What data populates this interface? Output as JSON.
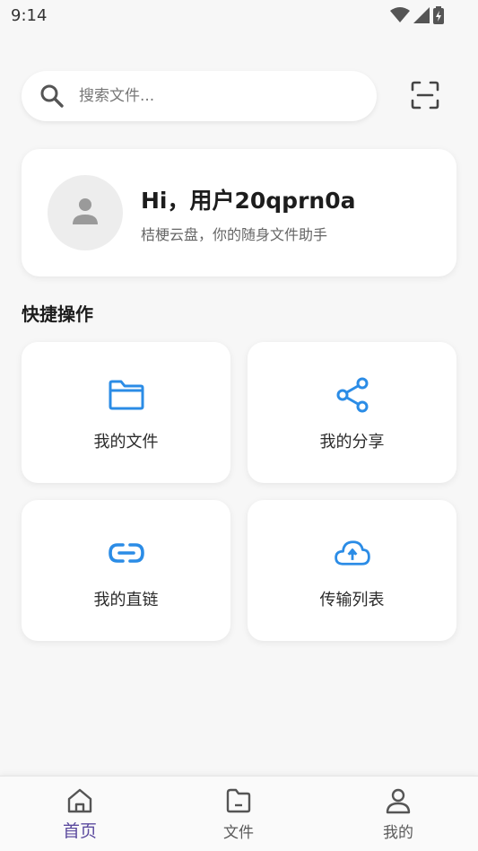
{
  "status_bar": {
    "time": "9:14"
  },
  "search": {
    "placeholder": "搜索文件..."
  },
  "profile": {
    "greeting": "Hi，用户20qprn0a",
    "subtitle": "桔梗云盘，你的随身文件助手"
  },
  "quick_actions": {
    "title": "快捷操作",
    "items": [
      {
        "label": "我的文件",
        "icon": "folder-icon"
      },
      {
        "label": "我的分享",
        "icon": "share-icon"
      },
      {
        "label": "我的直链",
        "icon": "link-icon"
      },
      {
        "label": "传输列表",
        "icon": "cloud-upload-icon"
      }
    ]
  },
  "bottom_nav": {
    "items": [
      {
        "label": "首页",
        "icon": "home-icon",
        "active": true
      },
      {
        "label": "文件",
        "icon": "file-folder-icon",
        "active": false
      },
      {
        "label": "我的",
        "icon": "person-icon",
        "active": false
      }
    ]
  },
  "colors": {
    "accent_blue": "#2b8ce6",
    "active_nav": "#5b4a9e",
    "background": "#f7f7f7"
  }
}
